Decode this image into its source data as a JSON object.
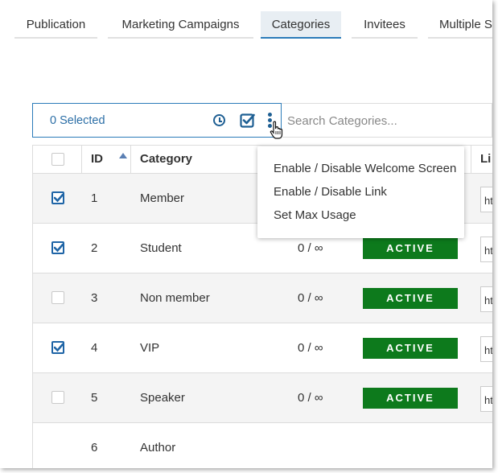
{
  "tabs": [
    "Publication",
    "Marketing Campaigns",
    "Categories",
    "Invitees",
    "Multiple S"
  ],
  "active_tab": "Categories",
  "toolbar": {
    "selected_label": "0 Selected",
    "search_placeholder": "Search Categories...",
    "icons": [
      "clock-icon",
      "check-square-icon",
      "kebab-menu-icon"
    ]
  },
  "table": {
    "columns": [
      "ID",
      "Category",
      "Li"
    ],
    "rows": [
      {
        "checked": true,
        "id": "1",
        "category": "Member",
        "usage": "",
        "status": "",
        "link": "ht"
      },
      {
        "checked": true,
        "id": "2",
        "category": "Student",
        "usage": "0 / ∞",
        "status": "ACTIVE",
        "link": "ht"
      },
      {
        "checked": false,
        "id": "3",
        "category": "Non member",
        "usage": "0 / ∞",
        "status": "ACTIVE",
        "link": "ht"
      },
      {
        "checked": true,
        "id": "4",
        "category": "VIP",
        "usage": "0 / ∞",
        "status": "ACTIVE",
        "link": "ht"
      },
      {
        "checked": false,
        "id": "5",
        "category": "Speaker",
        "usage": "0 / ∞",
        "status": "ACTIVE",
        "link": "ht"
      },
      {
        "checked": false,
        "id": "6",
        "category": "Author",
        "usage": "",
        "status": "",
        "link": ""
      }
    ]
  },
  "menu": {
    "items": [
      "Enable / Disable Welcome Screen",
      "Enable / Disable Link",
      "Set Max Usage"
    ]
  },
  "colors": {
    "accent": "#2b7bb9",
    "active_badge": "#0d7a1c",
    "checkbox": "#1e64a6"
  }
}
